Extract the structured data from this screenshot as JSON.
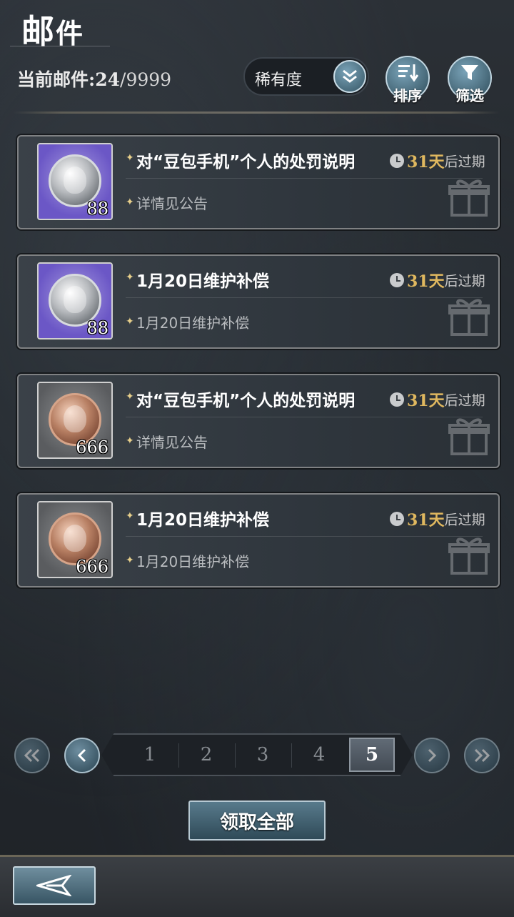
{
  "header": {
    "title_first": "邮",
    "title_rest": "件",
    "count_label": "当前邮件:",
    "count_current": "24",
    "count_total": "/9999",
    "sort_select": {
      "value": "稀有度"
    },
    "sort_button_label": "排序",
    "filter_button_label": "筛选"
  },
  "mails": [
    {
      "subject": "对“豆包手机”个人的处罚说明",
      "preview": "详情见公告",
      "quantity": "88",
      "days": "31天",
      "suffix": "后过期",
      "item": "silver-coin"
    },
    {
      "subject": "1月20日维护补偿",
      "preview": "1月20日维护补偿",
      "quantity": "88",
      "days": "31天",
      "suffix": "后过期",
      "item": "silver-coin"
    },
    {
      "subject": "对“豆包手机”个人的处罚说明",
      "preview": "详情见公告",
      "quantity": "666",
      "days": "31天",
      "suffix": "后过期",
      "item": "bronze-coin"
    },
    {
      "subject": "1月20日维护补偿",
      "preview": "1月20日维护补偿",
      "quantity": "666",
      "days": "31天",
      "suffix": "后过期",
      "item": "bronze-coin"
    }
  ],
  "pagination": {
    "pages": [
      "1",
      "2",
      "3",
      "4",
      "5"
    ],
    "current": "5"
  },
  "actions": {
    "claim_all_label": "领取全部"
  },
  "colors": {
    "accent_gold": "#e0b85f",
    "button_teal": "#4e6f80"
  }
}
